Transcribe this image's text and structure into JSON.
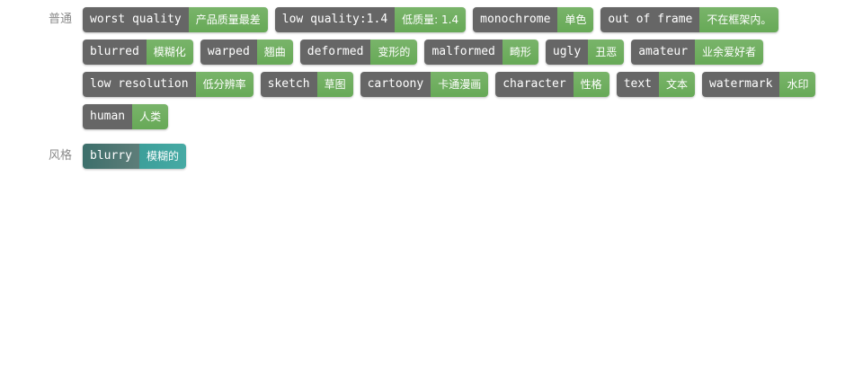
{
  "groups": [
    {
      "label": "普通",
      "tags": [
        {
          "en": "worst quality",
          "zh": "产品质量最差"
        },
        {
          "en": "low quality:1.4",
          "zh": "低质量: 1.4"
        },
        {
          "en": "monochrome",
          "zh": "单色"
        },
        {
          "en": "out of frame",
          "zh": "不在框架内。"
        },
        {
          "en": "blurred",
          "zh": "模糊化"
        },
        {
          "en": "warped",
          "zh": "翘曲"
        },
        {
          "en": "deformed",
          "zh": "变形的"
        },
        {
          "en": "malformed",
          "zh": "畸形"
        },
        {
          "en": "ugly",
          "zh": "丑恶"
        },
        {
          "en": "amateur",
          "zh": "业余爱好者"
        },
        {
          "en": "low resolution",
          "zh": "低分辨率"
        },
        {
          "en": "sketch",
          "zh": "草图"
        },
        {
          "en": "cartoony",
          "zh": "卡通漫画"
        },
        {
          "en": "character",
          "zh": "性格"
        },
        {
          "en": "text",
          "zh": "文本"
        },
        {
          "en": "watermark",
          "zh": "水印"
        },
        {
          "en": "human",
          "zh": "人类"
        }
      ]
    },
    {
      "label": "风格",
      "tags": [
        {
          "en": "blurry",
          "zh": "模糊的"
        }
      ]
    }
  ],
  "colors": {
    "tag_en_bg": "#666666",
    "tag_zh_bg": "#6fae5f",
    "style_en_bg": "#4d7874",
    "style_zh_bg": "#42a5a0",
    "label_text": "#8a8a8a"
  }
}
